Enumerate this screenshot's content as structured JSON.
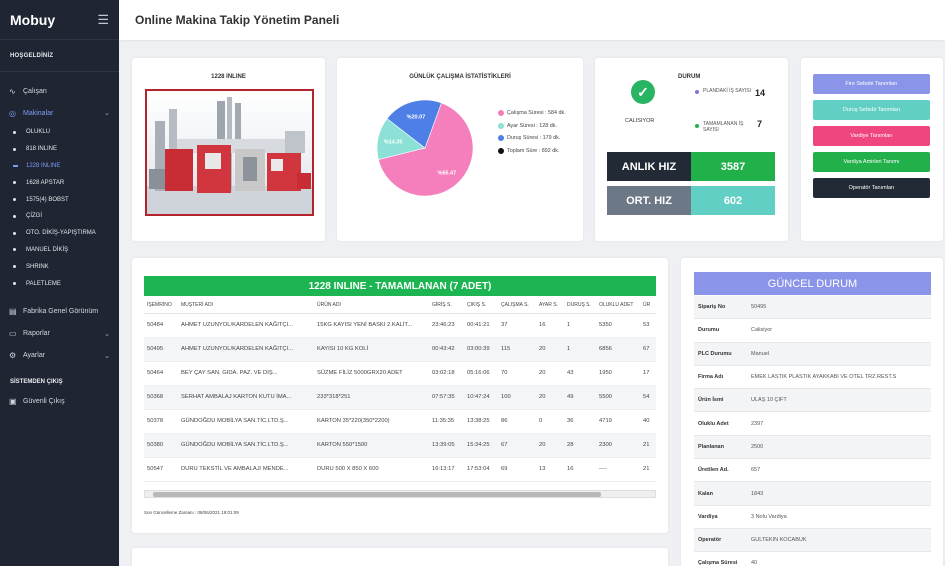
{
  "app": {
    "brand": "Mobuy",
    "title": "Online Makina Takip Yönetim Paneli"
  },
  "sidebar": {
    "welcome": "HOŞGELDİNİZ",
    "items": [
      {
        "label": "Çalışan",
        "icon": "activity-icon"
      },
      {
        "label": "Makinalar",
        "icon": "target-icon"
      }
    ],
    "machines": [
      "OLUKLU",
      "818 INLINE",
      "1228 INLINE",
      "1628 APSTAR",
      "1575(4) BOBST",
      "ÇİZGİ",
      "OTO. DİKİŞ-YAPIŞTIRMA",
      "MANUEL DİKİŞ",
      "SHRINK",
      "PALETLEME"
    ],
    "items2": [
      {
        "label": "Fabrika Genel Görünüm",
        "icon": "building-icon"
      },
      {
        "label": "Raporlar",
        "icon": "folder-icon"
      },
      {
        "label": "Ayarlar",
        "icon": "settings-icon"
      }
    ],
    "exit_section": "SİSTEMDEN ÇIKIŞ",
    "logout": "Güvenli Çıkış"
  },
  "machine_card": {
    "title": "1228 INLINE"
  },
  "stats": {
    "title": "GÜNLÜK ÇALIŞMA İSTATİSTİKLERİ",
    "legend": [
      {
        "label": "Çalışma Süresi : 584 dk.",
        "color": "#f47fbc"
      },
      {
        "label": "Ayar Süresi : 128 dk.",
        "color": "#8de0d6"
      },
      {
        "label": "Duruş Süresi : 179 dk.",
        "color": "#4e7fe6"
      },
      {
        "label": "Toplam Süre : 892 dk.",
        "color": "#111111"
      }
    ],
    "slice_labels": [
      "%65.47",
      "%14.35",
      "%20.07"
    ]
  },
  "chart_data": {
    "type": "pie",
    "categories": [
      "Çalışma Süresi",
      "Ayar Süresi",
      "Duruş Süresi"
    ],
    "values": [
      65.47,
      14.35,
      20.07
    ],
    "colors": [
      "#f47fbc",
      "#8de0d6",
      "#4e7fe6"
    ]
  },
  "durum": {
    "title": "DURUM",
    "status": "CALISIYOR",
    "planned_label": "PLANDAKİ İŞ SAYISI",
    "planned_value": "14",
    "done_label": "TAMAMLANAN İŞ SAYISI",
    "done_value": "7",
    "instant_label": "ANLIK HIZ",
    "instant_value": "3587",
    "avg_label": "ORT. HIZ",
    "avg_value": "602"
  },
  "buttons": [
    {
      "label": "Fire Sebebi Tanımları",
      "color": "#8a95ea"
    },
    {
      "label": "Duruş Sebebi Tanımları",
      "color": "#62cfc4"
    },
    {
      "label": "Vardiye Tanımları",
      "color": "#ef4680"
    },
    {
      "label": "Vardiya Amirleri Tanımı",
      "color": "#22b04b"
    },
    {
      "label": "Operatör Tanımları",
      "color": "#222a35"
    }
  ],
  "jobs": {
    "title": "1228 INLINE - TAMAMLANAN (7 ADET)",
    "columns": [
      "İŞEMRİNO",
      "MUŞTERİ ADI",
      "ÜRÜN ADI",
      "GİRİŞ S.",
      "ÇIKIŞ S.",
      "ÇALIŞMA S.",
      "AYAR S.",
      "DURUŞ S.",
      "OLUKLU ADET",
      "ÜR"
    ],
    "rows": [
      [
        "50484",
        "AHMET UZUNYOL/KARDELEN KAĞITÇI...",
        "15KG KAYISI YENİ BASKI 2.KALİT...",
        "23:46:23",
        "00:41:21",
        "37",
        "16",
        "1",
        "5350",
        "53"
      ],
      [
        "50495",
        "AHMET UZUNYOL/KARDELEN KAĞITÇI...",
        "KAYISI 10 KG KOLİ",
        "00:43:42",
        "03:00:39",
        "115",
        "20",
        "1",
        "6856",
        "67"
      ],
      [
        "50464",
        "BEY ÇAY SAN. GIDA. PAZ. VE DIŞ...",
        "SÜZME FİLİZ 5000GRX20 ADET",
        "03:02:18",
        "05:16:06",
        "70",
        "20",
        "43",
        "1950",
        "17"
      ],
      [
        "50368",
        "SERHAT AMBALAJ KARTON KUTU İMA...",
        "233*318*251",
        "07:57:35",
        "10:47:24",
        "100",
        "20",
        "49",
        "5500",
        "54"
      ],
      [
        "50378",
        "GÜNDOĞDU MOBİLYA SAN.TİC.LTD.Ş...",
        "KARTON 35*220(350*2200)",
        "11:35:35",
        "13:38:25",
        "86",
        "0",
        "36",
        "4719",
        "40"
      ],
      [
        "50380",
        "GÜNDOĞDU MOBİLYA SAN.TİC.LTD.Ş...",
        "KARTON 550*1500",
        "13:39:05",
        "15:34:25",
        "67",
        "20",
        "28",
        "2300",
        "21"
      ],
      [
        "50547",
        "DURU TEKSTİL VE AMBALAJ/ MENDE...",
        "DURU 500 X 850 X 600",
        "16:13:17",
        "17:53:04",
        "69",
        "13",
        "16",
        "----",
        "21"
      ]
    ],
    "updated": "Son Güncelleme Zamanı : 08/06/2021 19:01:09"
  },
  "guncel": {
    "title": "GÜNCEL DURUM",
    "rows": [
      {
        "k": "Sipariş No",
        "v": "50495"
      },
      {
        "k": "Durumu",
        "v": "Calisiyor"
      },
      {
        "k": "PLC Durumu",
        "v": "Manuel"
      },
      {
        "k": "Firma Adı",
        "v": "EMEK LASTİK PLASTİK AYAKKABI VE OTEL TRZ.REST.S"
      },
      {
        "k": "Ürün İsmi",
        "v": "ULAŞ 10 ÇİFT"
      },
      {
        "k": "Oluklu Adet",
        "v": "2397"
      },
      {
        "k": "Planlanan",
        "v": "2500"
      },
      {
        "k": "Üretilen Ad.",
        "v": "657"
      },
      {
        "k": "Kalan",
        "v": "1843"
      },
      {
        "k": "Vardiya",
        "v": "3 Nolu Vardiya"
      },
      {
        "k": "Operatör",
        "v": "GÜLTEKİN KOCABÜK"
      },
      {
        "k": "Çalışma Süresi",
        "v": "40"
      }
    ]
  }
}
